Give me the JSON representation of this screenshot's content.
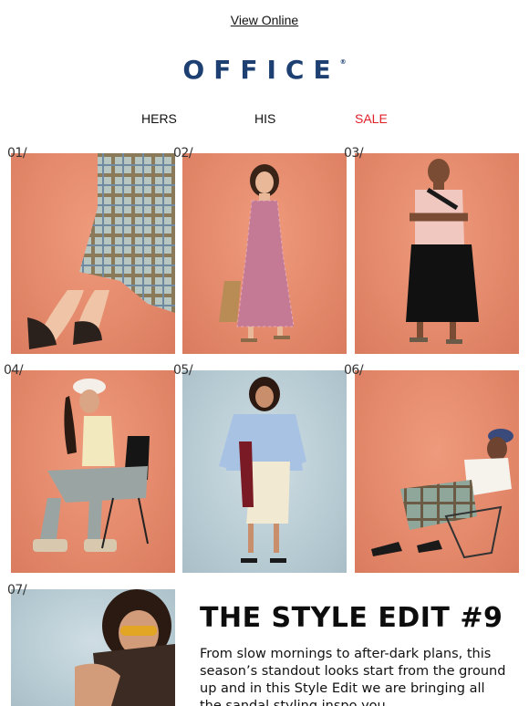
{
  "header": {
    "view_online": "View Online",
    "logo_text": "OFFICE",
    "logo_mark": "®"
  },
  "nav": {
    "hers": "HERS",
    "his": "HIS",
    "sale": "SALE"
  },
  "colors": {
    "brand": "#1d3f72",
    "sale": "#e2202a",
    "backdrop_orange": "#e58a6c",
    "backdrop_blue": "#b8ccd4"
  },
  "looks": [
    {
      "num": "01/",
      "image": "plaid-skirt-toe-post-sandals"
    },
    {
      "num": "02/",
      "image": "gingham-dress-with-bag"
    },
    {
      "num": "03/",
      "image": "mesh-top-wide-shorts"
    },
    {
      "num": "04/",
      "image": "bucket-hat-chair-pose"
    },
    {
      "num": "05/",
      "image": "stripe-shirt-lace-skirt"
    },
    {
      "num": "06/",
      "image": "plaid-skirt-chair-pose"
    },
    {
      "num": "07/",
      "image": "sunglasses-close-up"
    }
  ],
  "edit": {
    "title": "THE STYLE EDIT #9",
    "body": "From slow mornings to after-dark plans, this season’s standout looks start from the ground up and in this Style Edit we are bringing all the sandal styling inspo you"
  }
}
